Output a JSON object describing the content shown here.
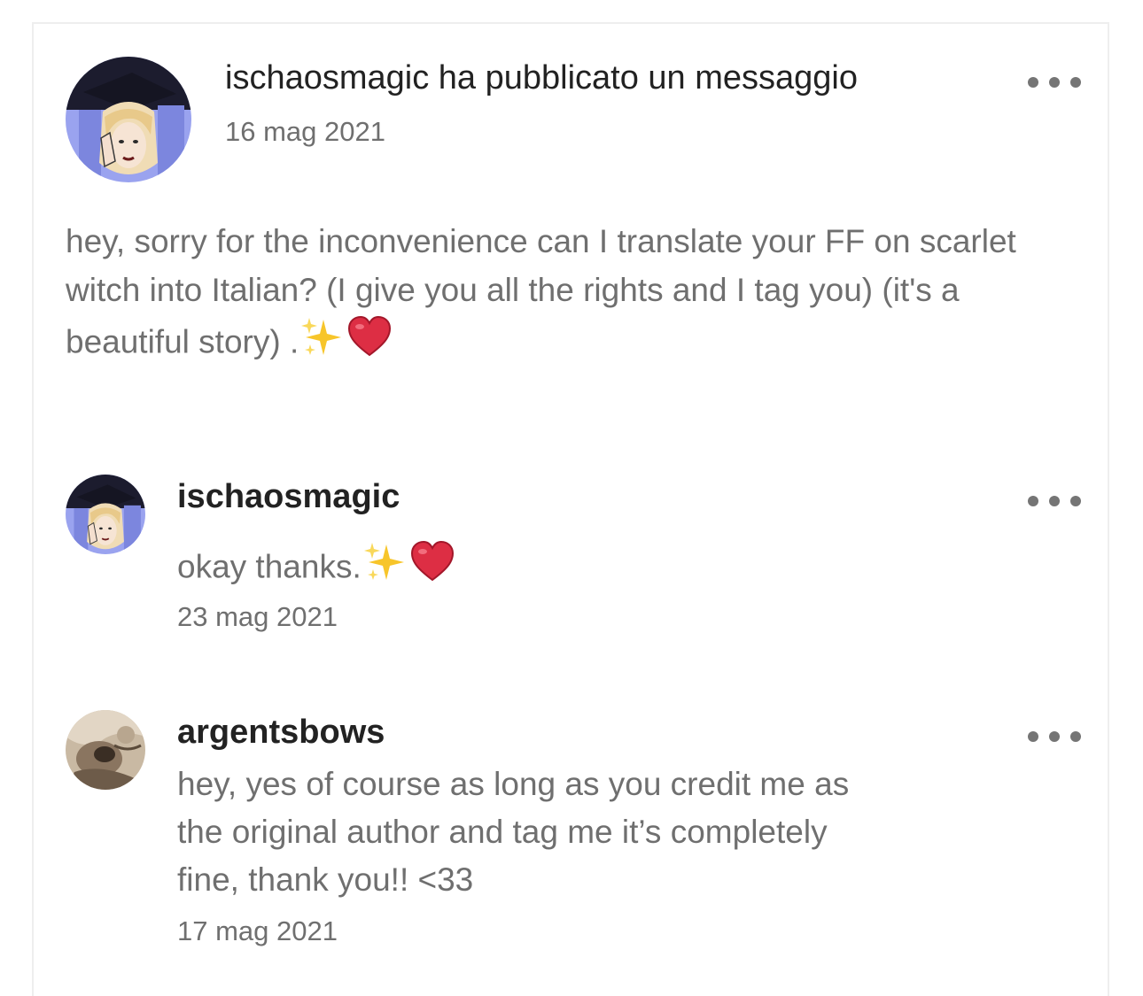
{
  "post": {
    "author": "ischaosmagic",
    "title": "ischaosmagic ha pubblicato un messaggio",
    "date": "16 mag 2021",
    "body": "hey, sorry for the inconvenience can I translate your FF on scarlet witch into Italian? (I give you all the rights and I tag you) (it's a beautiful story) .",
    "emojis": [
      "sparkles-icon",
      "red-heart-icon"
    ]
  },
  "comments": [
    {
      "username": "ischaosmagic",
      "text": "okay thanks.",
      "date": "23 mag 2021",
      "emojis": [
        "sparkles-icon",
        "red-heart-icon"
      ]
    },
    {
      "username": "argentsbows",
      "text": "hey, yes of course as long as you credit me as the original author and tag me it’s completely fine, thank you!! <33",
      "date": "17 mag 2021"
    }
  ],
  "icons": {
    "more": "more-options-icon"
  },
  "colors": {
    "primary_text": "#222222",
    "secondary_text": "#6f6f6f",
    "icon_gray": "#757575",
    "border": "#eeeeee",
    "avatar_accent": "#8a93e6"
  }
}
